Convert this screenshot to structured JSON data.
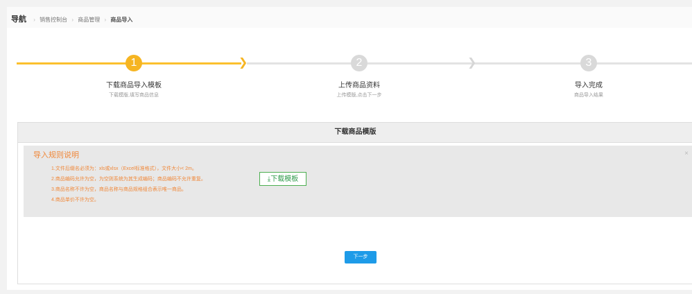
{
  "breadcrumb": {
    "nav": "导航",
    "items": [
      "销售控制台",
      "商品管理",
      "商品导入"
    ]
  },
  "steps": [
    {
      "num": "1",
      "title": "下载商品导入模板",
      "desc": "下载模版,填写商品信息",
      "state": "active"
    },
    {
      "num": "2",
      "title": "上传商品资料",
      "desc": "上传模版,点击下一步",
      "state": "pending"
    },
    {
      "num": "3",
      "title": "导入完成",
      "desc": "商品导入结果",
      "state": "pending"
    }
  ],
  "panel": {
    "title": "下载商品模版",
    "rules_title": "导入规则说明",
    "rules": [
      "1.文件后缀名必须为：xls或xlsx（Excel标准格式），文件大小< 2m。",
      "2.商品编码允许为空，为空则系统为其生成编码；商品编码不允许重复。",
      "3.商品名称不许为空，商品名称与商品规格组合表示唯一商品。",
      "4.商品单价不许为空。"
    ],
    "download_label": "下载模板",
    "close_glyph": "×",
    "next_label": "下一步"
  },
  "colors": {
    "accent": "#f6b522",
    "rules_text": "#f0883a",
    "download": "#2e9a4a",
    "primary": "#1e9be8"
  }
}
